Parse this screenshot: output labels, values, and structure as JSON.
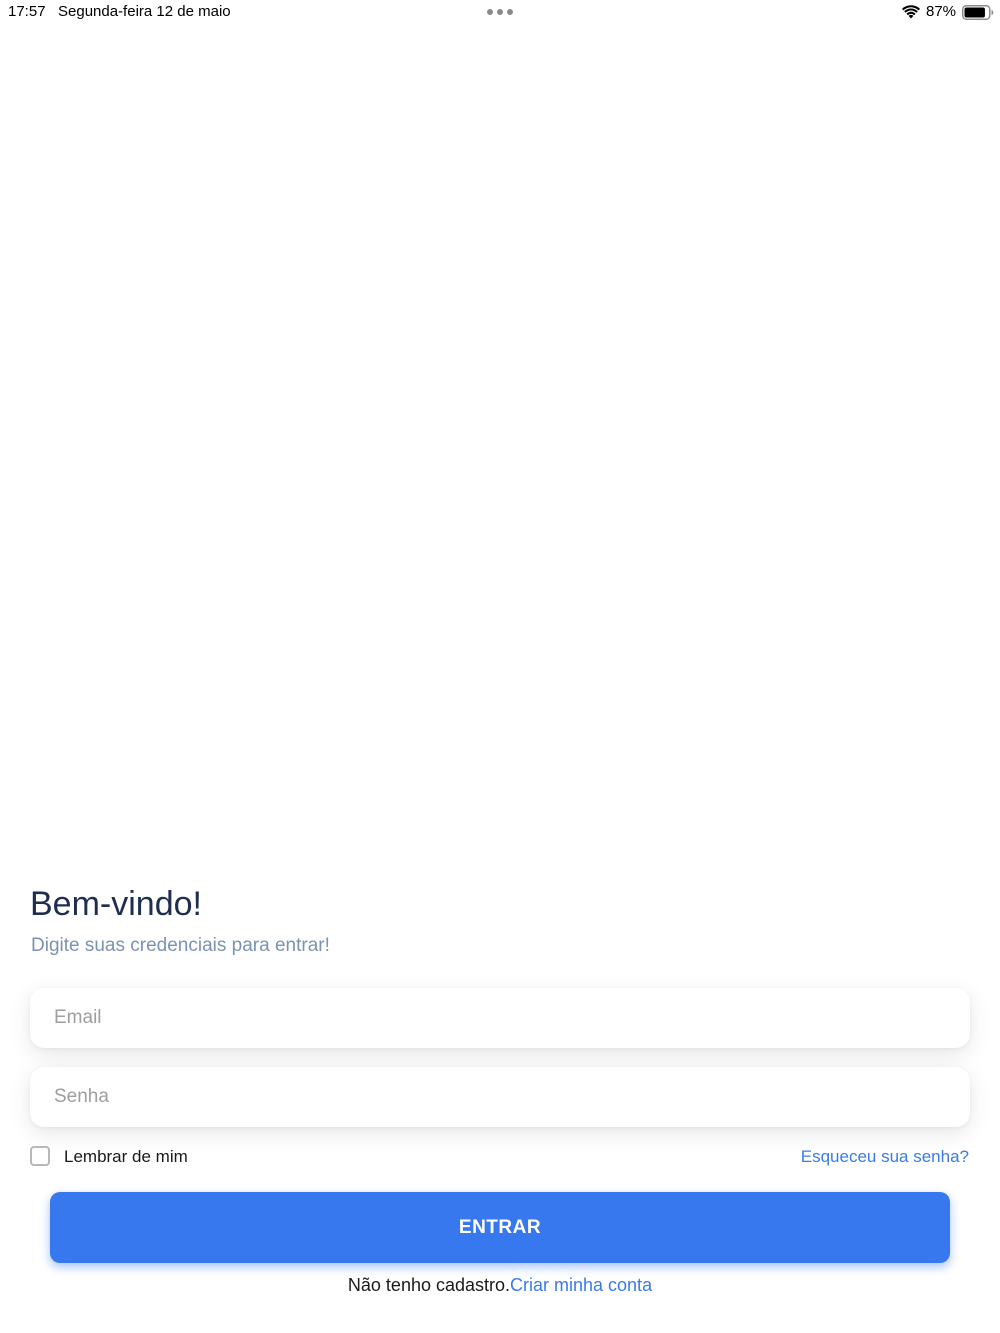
{
  "status_bar": {
    "time": "17:57",
    "date": "Segunda-feira 12 de maio",
    "battery_percent": "87%",
    "battery_level": 0.87,
    "icons": [
      "wifi-icon",
      "battery-icon",
      "multitask-dots-icon"
    ]
  },
  "login": {
    "title": "Bem-vindo!",
    "subtitle": "Digite suas credenciais para entrar!",
    "email": {
      "placeholder": "Email",
      "value": ""
    },
    "password": {
      "placeholder": "Senha",
      "value": ""
    },
    "remember_me": {
      "label": "Lembrar de mim",
      "checked": false
    },
    "forgot_password_label": "Esqueceu sua senha?",
    "submit_label": "ENTRAR",
    "signup_prompt": "Não tenho cadastro.",
    "signup_link": "Criar minha conta"
  },
  "colors": {
    "title": "#1f2d52",
    "subtitle": "#7b93b3",
    "link": "#3a7bea",
    "button": "#3878ee",
    "button_text": "#ffffff"
  }
}
